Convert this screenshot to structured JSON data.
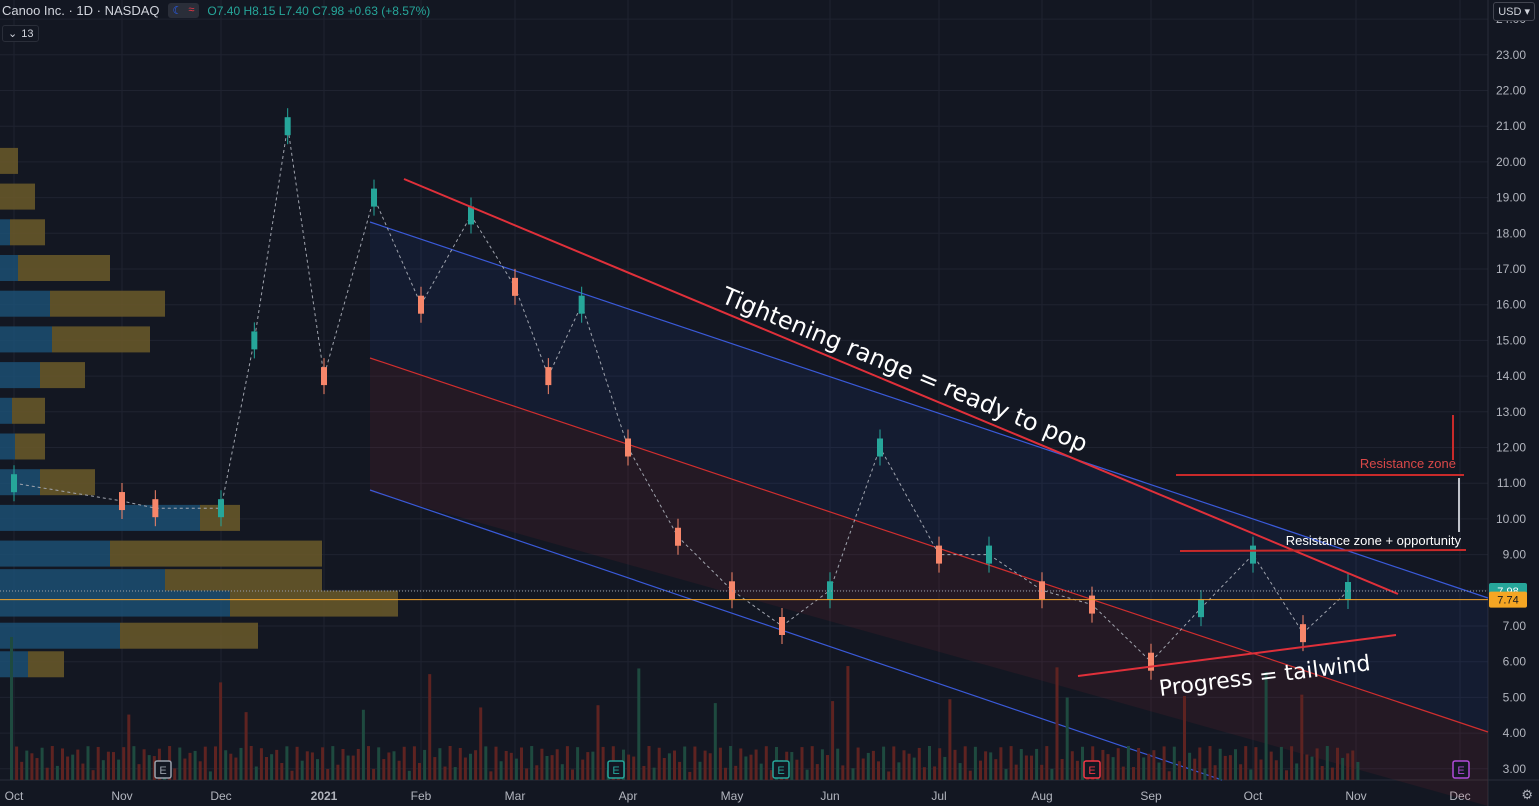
{
  "header": {
    "symbol": "Canoo Inc. · 1D · NASDAQ",
    "ohlc": "O7.40 H8.15 L7.40 C7.98 +0.63 (+8.57%)",
    "indicator_badge": "13",
    "currency": "USD"
  },
  "colors": {
    "background": "#131722",
    "up": "#26a69a",
    "down": "#f7866a",
    "volume_up": "#1e4a3f",
    "volume_down": "#5e2321",
    "channel_blue": "#3a5ad9",
    "channel_red": "#d02e2e",
    "vp_blue": "#1c4f73",
    "vp_gold": "#6b5a2a",
    "grid": "#1f2330"
  },
  "chart_data": {
    "type": "line",
    "title": "Canoo Inc. 1D NASDAQ",
    "x_tick_labels": [
      "Oct",
      "Nov",
      "Dec",
      "2021",
      "Feb",
      "Mar",
      "Apr",
      "May",
      "Jun",
      "Jul",
      "Aug",
      "Sep",
      "Oct",
      "Nov",
      "Dec"
    ],
    "y_tick_labels": [
      "3.00",
      "4.00",
      "5.00",
      "6.00",
      "7.00",
      "8.00",
      "9.00",
      "10.00",
      "11.00",
      "12.00",
      "13.00",
      "14.00",
      "15.00",
      "16.00",
      "17.00",
      "18.00",
      "19.00",
      "20.00",
      "21.00",
      "22.00",
      "23.00",
      "24.00"
    ],
    "ylim": [
      2.7,
      24.3
    ],
    "series": [
      {
        "x": [
          "Oct",
          "Nov",
          "Nov",
          "Dec",
          "Dec",
          "Dec",
          "2021",
          "2021",
          "Feb",
          "Feb",
          "Mar",
          "Mar",
          "Mar",
          "Apr",
          "Apr",
          "May",
          "May",
          "Jun",
          "Jun",
          "Jul",
          "Jul",
          "Aug",
          "Aug",
          "Sep",
          "Sep",
          "Oct",
          "Oct",
          "Nov"
        ],
        "values": [
          11.0,
          10.5,
          10.3,
          10.3,
          15.0,
          21.0,
          14.0,
          19.0,
          16.0,
          18.5,
          16.5,
          14.0,
          16.0,
          12.0,
          9.5,
          8.0,
          7.0,
          8.0,
          12.0,
          9.0,
          9.0,
          8.0,
          7.6,
          6.0,
          7.5,
          9.0,
          6.8,
          7.98
        ]
      }
    ],
    "last_price": "7.98",
    "ma_price": "7.74",
    "annotations": [
      "Tightening range = ready to pop",
      "Progress = tailwind",
      "Resistance zone",
      "Resistance zone + opportunity"
    ],
    "earnings_markers": [
      "E",
      "E",
      "E",
      "E",
      "E"
    ],
    "grid": true
  }
}
